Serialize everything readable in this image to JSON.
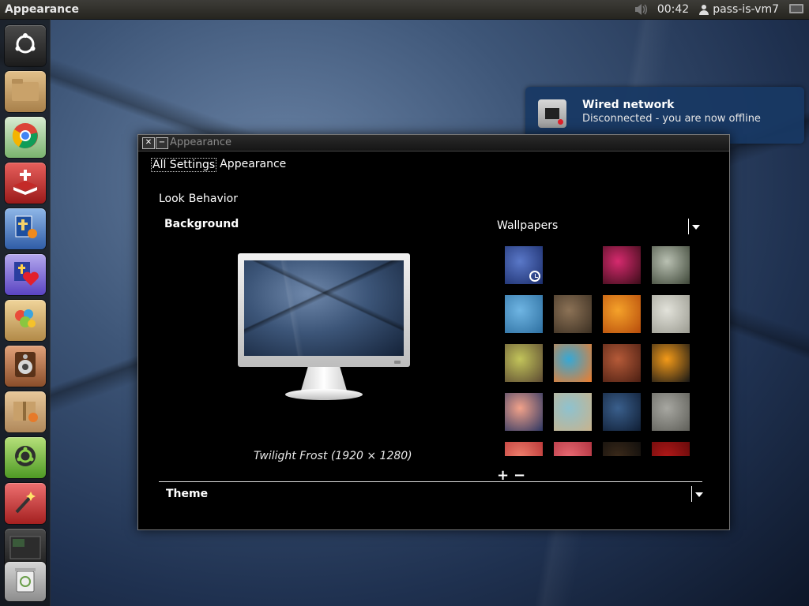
{
  "panel": {
    "app_title": "Appearance",
    "clock": "00:42",
    "username": "pass-is-vm7"
  },
  "launcher": {
    "items": [
      {
        "icon": "dash-home-icon"
      },
      {
        "icon": "files-folder-icon"
      },
      {
        "icon": "chrome-browser-icon"
      },
      {
        "icon": "bible-book-icon"
      },
      {
        "icon": "bible-study-icon"
      },
      {
        "icon": "cross-heart-icon"
      },
      {
        "icon": "paint-app-icon"
      },
      {
        "icon": "speaker-app-icon"
      },
      {
        "icon": "package-icon"
      },
      {
        "icon": "ubuntu-software-icon"
      },
      {
        "icon": "magic-wand-icon"
      },
      {
        "icon": "workspace-switcher-icon"
      },
      {
        "icon": "trash-icon"
      }
    ]
  },
  "window": {
    "title": "Appearance",
    "breadcrumb_home": "All Settings",
    "breadcrumb_current": "Appearance",
    "tabs": [
      "Look",
      "Behavior"
    ],
    "background_heading": "Background",
    "wallpapers_label": "Wallpapers",
    "caption": "Twilight Frost (1920 × 1280)",
    "add_label": "+",
    "remove_label": "−",
    "theme_heading": "Theme"
  },
  "wallpapers": [
    {
      "c1": "#5a78c8",
      "c2": "#1b2d6b",
      "clock": true
    },
    {
      "c1": "#000000",
      "c2": "#000000"
    },
    {
      "c1": "#d62a6e",
      "c2": "#3a0c18"
    },
    {
      "c1": "#b9c0b2",
      "c2": "#3d4637"
    },
    {
      "c1": "#6fb5e3",
      "c2": "#2d6fa0"
    },
    {
      "c1": "#8c7256",
      "c2": "#3b2f22"
    },
    {
      "c1": "#f5a22a",
      "c2": "#b64b0b"
    },
    {
      "c1": "#e2e2da",
      "c2": "#9a9a90"
    },
    {
      "c1": "#c2c45a",
      "c2": "#5c4a32"
    },
    {
      "c1": "#36a8d6",
      "c2": "#f07c2a"
    },
    {
      "c1": "#b55a38",
      "c2": "#4a1e12"
    },
    {
      "c1": "#f39a19",
      "c2": "#161616"
    },
    {
      "c1": "#f2a28a",
      "c2": "#2a3562"
    },
    {
      "c1": "#8ec2cf",
      "c2": "#c9b38c"
    },
    {
      "c1": "#3a5f8c",
      "c2": "#0f1d33"
    },
    {
      "c1": "#a7a7a1",
      "c2": "#5e5e58"
    },
    {
      "c1": "#ee7f6c",
      "c2": "#b42e32"
    },
    {
      "c1": "#e86a72",
      "c2": "#a82c3a"
    },
    {
      "c1": "#3b2a1a",
      "c2": "#0a0a0a"
    },
    {
      "c1": "#b01818",
      "c2": "#5a0808"
    }
  ],
  "notification": {
    "title": "Wired network",
    "body": "Disconnected - you are now offline"
  }
}
